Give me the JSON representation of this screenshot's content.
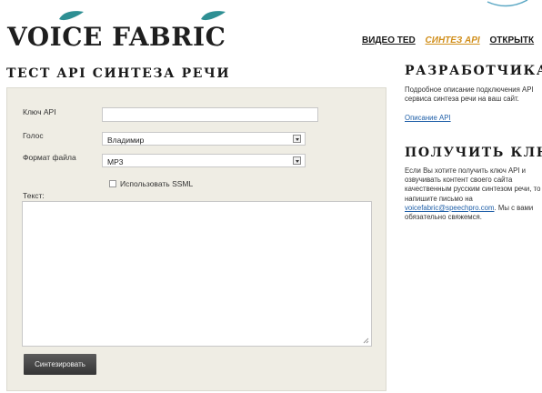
{
  "header": {
    "logo_text": "VOICE FABRIC",
    "nav": [
      "ВИДЕО TED",
      "СИНТЕЗ API",
      "ОТКРЫТК"
    ],
    "active_nav_index": 1
  },
  "main": {
    "title": "ТЕСТ API СИНТЕЗА РЕЧИ",
    "form": {
      "api_key_label": "Ключ API",
      "api_key_value": "",
      "voice_label": "Голос",
      "voice_value": "Владимир",
      "format_label": "Формат файла",
      "format_value": "MP3",
      "ssml_label": "Использовать SSML",
      "ssml_checked": false,
      "text_label": "Текст:",
      "text_value": "",
      "submit_label": "Синтезировать"
    }
  },
  "sidebar": {
    "dev_title": "РАЗРАБОТЧИКАМ",
    "dev_desc": "Подробное описание подключения API сервиса синтеза речи на ваш сайт.",
    "dev_link": "Описание API",
    "key_title": "ПОЛУЧИТЬ КЛЮЧ",
    "key_text_1": "Если Вы хотите получить ключ API и озвучивать контент своего сайта качественным русским синтезом речи, то напишите письмо на ",
    "key_email": "voicefabric@speechpro.com",
    "key_text_2": ". Мы с вами обязательно свяжемся."
  },
  "colors": {
    "accent": "#d18f1c",
    "bird": "#2e8f93",
    "form_bg": "#efede4",
    "button": "#454545",
    "link": "#1f5fa8"
  }
}
